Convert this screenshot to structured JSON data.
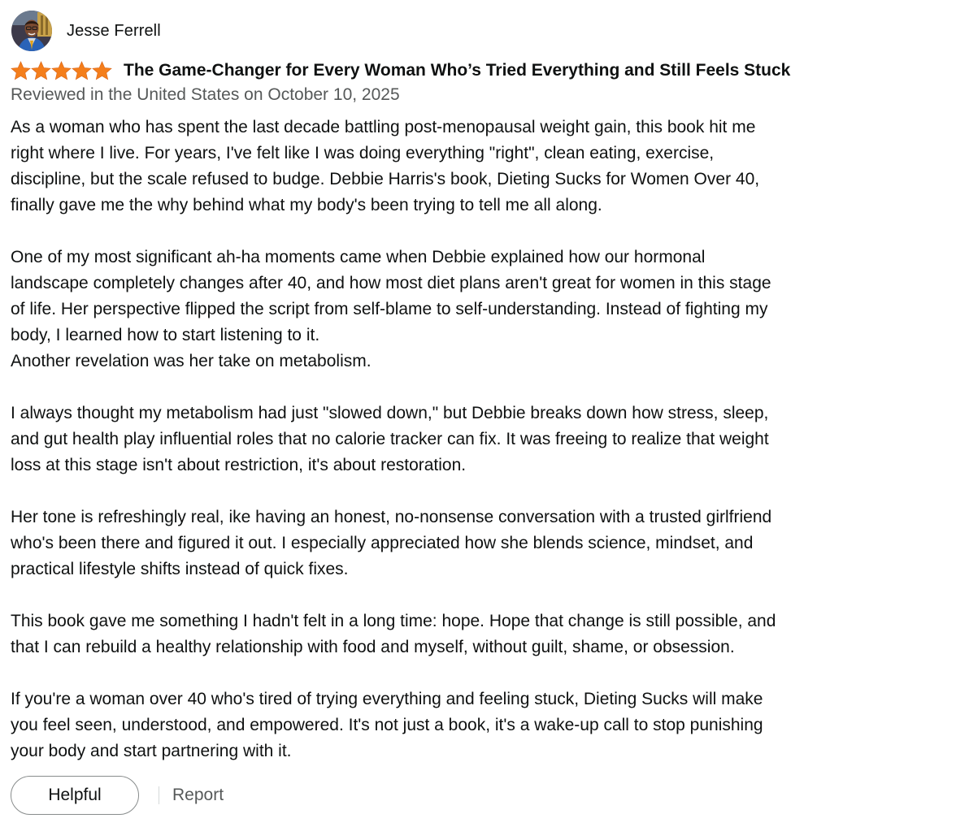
{
  "reviewer": {
    "name": "Jesse Ferrell",
    "avatar": "profile-photo"
  },
  "rating": {
    "stars": 5,
    "max": 5,
    "color": "#f47e1b"
  },
  "review": {
    "title": "The Game-Changer for Every Woman Who’s Tried Everything and Still Feels Stuck",
    "date": "Reviewed in the United States on October 10, 2025",
    "paragraphs": [
      {
        "lines": [
          "As a woman who has spent the last decade battling post-menopausal weight gain, this book hit me",
          "right where I live. For years, I've felt like I was doing everything \"right\", clean eating, exercise,",
          "discipline, but the scale refused to budge. Debbie Harris's book, Dieting Sucks for Women Over 40,",
          "finally gave me the why behind what my body's been trying to tell me all along."
        ]
      },
      {
        "lines": [
          "One of my most significant ah-ha moments came when Debbie explained how our hormonal",
          "landscape completely changes after 40, and how most diet plans aren't great for women in this stage",
          "of life. Her perspective flipped the script from self-blame to self-understanding. Instead of fighting my",
          "body, I learned how to start listening to it.",
          "Another revelation was her take on metabolism."
        ]
      },
      {
        "lines": [
          "I always thought my metabolism had just \"slowed down,\" but Debbie breaks down how stress, sleep,",
          "and gut health play influential roles that no calorie tracker can fix. It was freeing to realize that weight",
          "loss at this stage isn't about restriction, it's about restoration."
        ]
      },
      {
        "lines": [
          "Her tone is refreshingly real, ike having an honest, no-nonsense conversation with a trusted girlfriend",
          "who's been there and figured it out. I especially appreciated how she blends science, mindset, and",
          "practical lifestyle shifts instead of quick fixes."
        ]
      },
      {
        "lines": [
          "This book gave me something I hadn't felt in a long time: hope. Hope that change is still possible, and",
          "that I can rebuild a healthy relationship with food and myself, without guilt, shame, or obsession."
        ]
      },
      {
        "lines": [
          "If you're a woman over 40 who's tired of trying everything and feeling stuck, Dieting Sucks will make",
          "you feel seen, understood, and empowered. It's not just a book, it's a wake-up call to stop punishing",
          "your body and start partnering with it."
        ]
      }
    ]
  },
  "actions": {
    "helpful_label": "Helpful",
    "report_label": "Report"
  },
  "colors": {
    "text": "#0f1111",
    "secondary_text": "#565959",
    "button_border": "#888c8c",
    "divider": "#d5d9d9",
    "star": "#f47e1b"
  }
}
